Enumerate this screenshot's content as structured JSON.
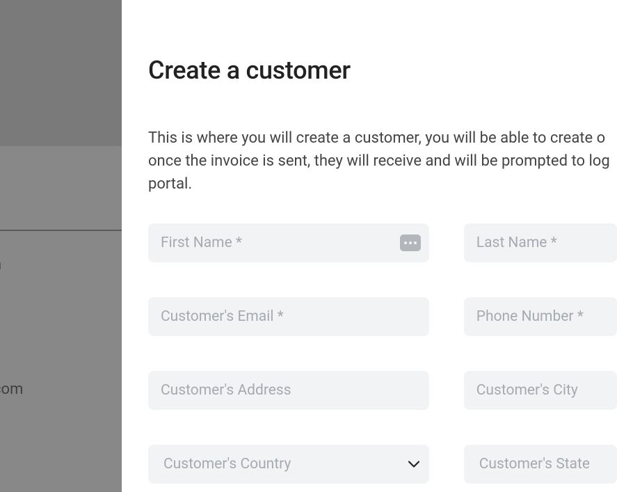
{
  "backdrop": {
    "text1": "n",
    "text2": "com"
  },
  "header": {
    "title": "Create a customer"
  },
  "description": {
    "line1": "This is where you will create a customer, you will be able to create o",
    "line2": "once the invoice is sent, they will receive and will be prompted to log",
    "line3": "portal."
  },
  "form": {
    "first_name": {
      "placeholder": "First Name *"
    },
    "last_name": {
      "placeholder": "Last Name *"
    },
    "email": {
      "placeholder": "Customer's Email *"
    },
    "phone": {
      "placeholder": "Phone Number *"
    },
    "address": {
      "placeholder": "Customer's Address"
    },
    "city": {
      "placeholder": "Customer's City"
    },
    "country": {
      "placeholder": "Customer's Country"
    },
    "state": {
      "placeholder": "Customer's State"
    }
  }
}
